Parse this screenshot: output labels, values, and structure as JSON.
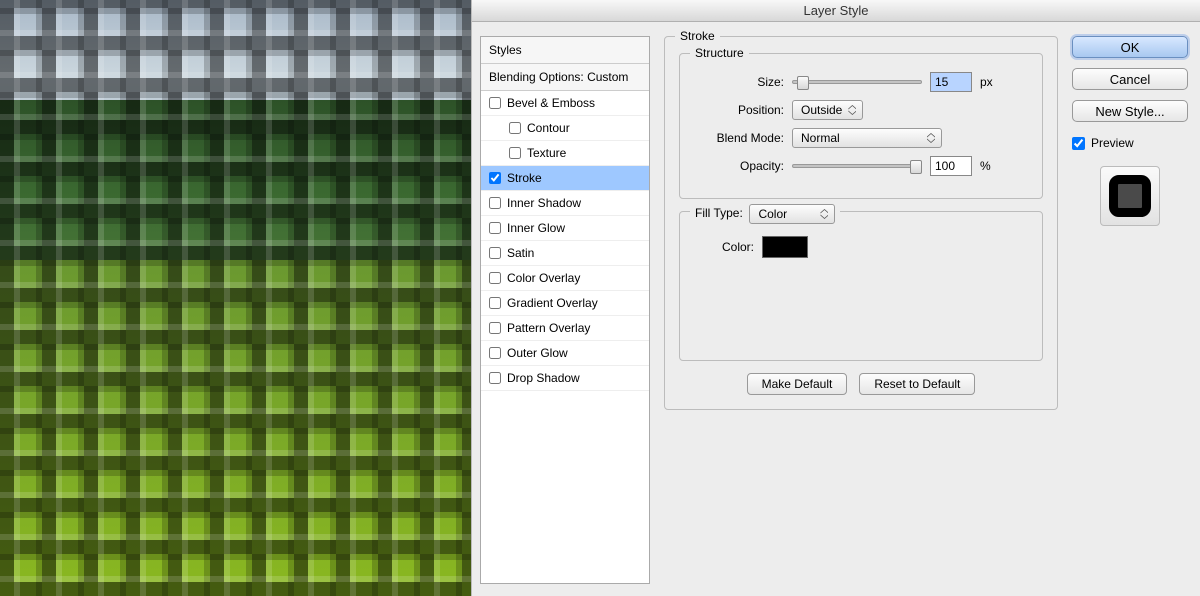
{
  "dialog": {
    "title": "Layer Style"
  },
  "stylesPanel": {
    "header": "Styles",
    "subheader": "Blending Options: Custom",
    "items": [
      {
        "label": "Bevel & Emboss",
        "checked": false,
        "indent": false,
        "selected": false
      },
      {
        "label": "Contour",
        "checked": false,
        "indent": true,
        "selected": false
      },
      {
        "label": "Texture",
        "checked": false,
        "indent": true,
        "selected": false
      },
      {
        "label": "Stroke",
        "checked": true,
        "indent": false,
        "selected": true
      },
      {
        "label": "Inner Shadow",
        "checked": false,
        "indent": false,
        "selected": false
      },
      {
        "label": "Inner Glow",
        "checked": false,
        "indent": false,
        "selected": false
      },
      {
        "label": "Satin",
        "checked": false,
        "indent": false,
        "selected": false
      },
      {
        "label": "Color Overlay",
        "checked": false,
        "indent": false,
        "selected": false
      },
      {
        "label": "Gradient Overlay",
        "checked": false,
        "indent": false,
        "selected": false
      },
      {
        "label": "Pattern Overlay",
        "checked": false,
        "indent": false,
        "selected": false
      },
      {
        "label": "Outer Glow",
        "checked": false,
        "indent": false,
        "selected": false
      },
      {
        "label": "Drop Shadow",
        "checked": false,
        "indent": false,
        "selected": false
      }
    ]
  },
  "settings": {
    "panelTitle": "Stroke",
    "structure": {
      "title": "Structure",
      "sizeLabel": "Size:",
      "sizeValue": "15",
      "sizeUnit": "px",
      "positionLabel": "Position:",
      "positionValue": "Outside",
      "blendModeLabel": "Blend Mode:",
      "blendModeValue": "Normal",
      "opacityLabel": "Opacity:",
      "opacityValue": "100",
      "opacityUnit": "%"
    },
    "fillType": {
      "title": "Fill Type:",
      "value": "Color",
      "colorLabel": "Color:",
      "colorValue": "#000000"
    },
    "makeDefault": "Make Default",
    "resetDefault": "Reset to Default"
  },
  "actions": {
    "ok": "OK",
    "cancel": "Cancel",
    "newStyle": "New Style...",
    "previewLabel": "Preview",
    "previewChecked": true
  }
}
